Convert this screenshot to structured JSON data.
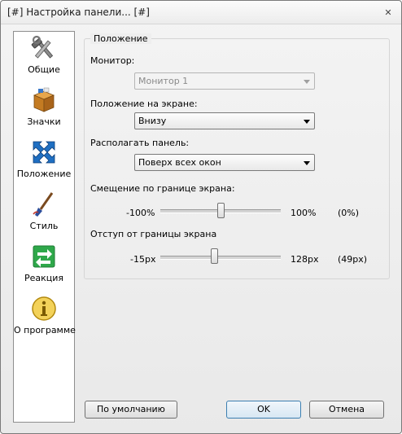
{
  "window": {
    "title": "[#] Настройка панели... [#]",
    "close_glyph": "✕"
  },
  "sidebar": {
    "items": [
      {
        "label": "Общие",
        "icon": "tools-icon"
      },
      {
        "label": "Значки",
        "icon": "box-icon"
      },
      {
        "label": "Положение",
        "icon": "move-arrows-icon"
      },
      {
        "label": "Стиль",
        "icon": "brush-icon"
      },
      {
        "label": "Реакция",
        "icon": "swap-arrows-icon"
      },
      {
        "label": "О программе",
        "icon": "info-icon"
      }
    ],
    "selected": "Положение"
  },
  "group": {
    "title": "Положение",
    "monitor": {
      "label": "Монитор:",
      "value": "Монитор 1",
      "disabled": true
    },
    "screen_position": {
      "label": "Положение на экране:",
      "value": "Внизу"
    },
    "panel_layer": {
      "label": "Располагать панель:",
      "value": "Поверх всех окон"
    },
    "edge_offset": {
      "label": "Смещение по границе экрана:",
      "min_label": "-100%",
      "max_label": "100%",
      "current_label": "(0%)",
      "min": -100,
      "max": 100,
      "value": 0
    },
    "edge_margin": {
      "label": "Отступ от границы экрана",
      "min_label": "-15px",
      "max_label": "128px",
      "current_label": "(49px)",
      "min": -15,
      "max": 128,
      "value": 49
    }
  },
  "buttons": {
    "defaults": "По умолчанию",
    "ok": "OK",
    "cancel": "Отмена"
  },
  "colors": {
    "accent": "#3c7fb1",
    "tools_blue": "#1f6fc2",
    "reaction_green": "#2ea84a",
    "info_gold": "#e0b21c"
  }
}
